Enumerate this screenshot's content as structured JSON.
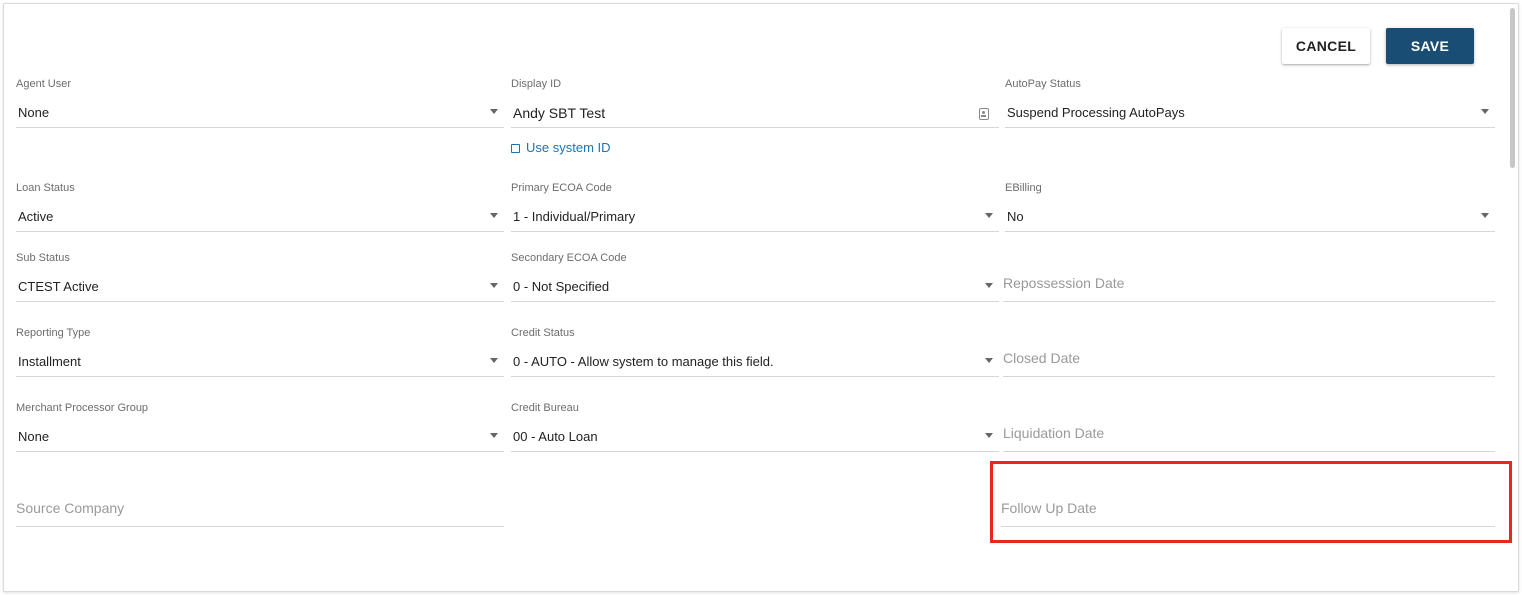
{
  "toolbar": {
    "cancel_label": "CANCEL",
    "save_label": "SAVE"
  },
  "fields": {
    "agent_user": {
      "label": "Agent User",
      "value": "None"
    },
    "display_id": {
      "label": "Display ID",
      "value": "Andy SBT Test"
    },
    "autopay_status": {
      "label": "AutoPay Status",
      "value": "Suspend Processing AutoPays"
    },
    "use_system_id": {
      "label": "Use system ID",
      "checked": false
    },
    "loan_status": {
      "label": "Loan Status",
      "value": "Active"
    },
    "primary_ecoa": {
      "label": "Primary ECOA Code",
      "value": "1 - Individual/Primary"
    },
    "ebilling": {
      "label": "EBilling",
      "value": "No"
    },
    "sub_status": {
      "label": "Sub Status",
      "value": "CTEST Active"
    },
    "secondary_ecoa": {
      "label": "Secondary ECOA Code",
      "value": "0 - Not Specified"
    },
    "repossession_date": {
      "placeholder": "Repossession Date"
    },
    "reporting_type": {
      "label": "Reporting Type",
      "value": "Installment"
    },
    "credit_status": {
      "label": "Credit Status",
      "value": "0 - AUTO - Allow system to manage this field."
    },
    "closed_date": {
      "placeholder": "Closed Date"
    },
    "merchant_processor_group": {
      "label": "Merchant Processor Group",
      "value": "None"
    },
    "credit_bureau": {
      "label": "Credit Bureau",
      "value": "00 - Auto Loan"
    },
    "liquidation_date": {
      "placeholder": "Liquidation Date"
    },
    "source_company": {
      "placeholder": "Source Company"
    },
    "follow_up_date": {
      "placeholder": "Follow Up Date"
    }
  },
  "icons": {
    "select_caret": "chevron-down-icon",
    "display_id_icon": "id-card-icon",
    "checkbox": "checkbox-icon"
  },
  "colors": {
    "save_button": "#1a4d74",
    "link": "#1a73b8",
    "highlight": "#e8281c"
  }
}
